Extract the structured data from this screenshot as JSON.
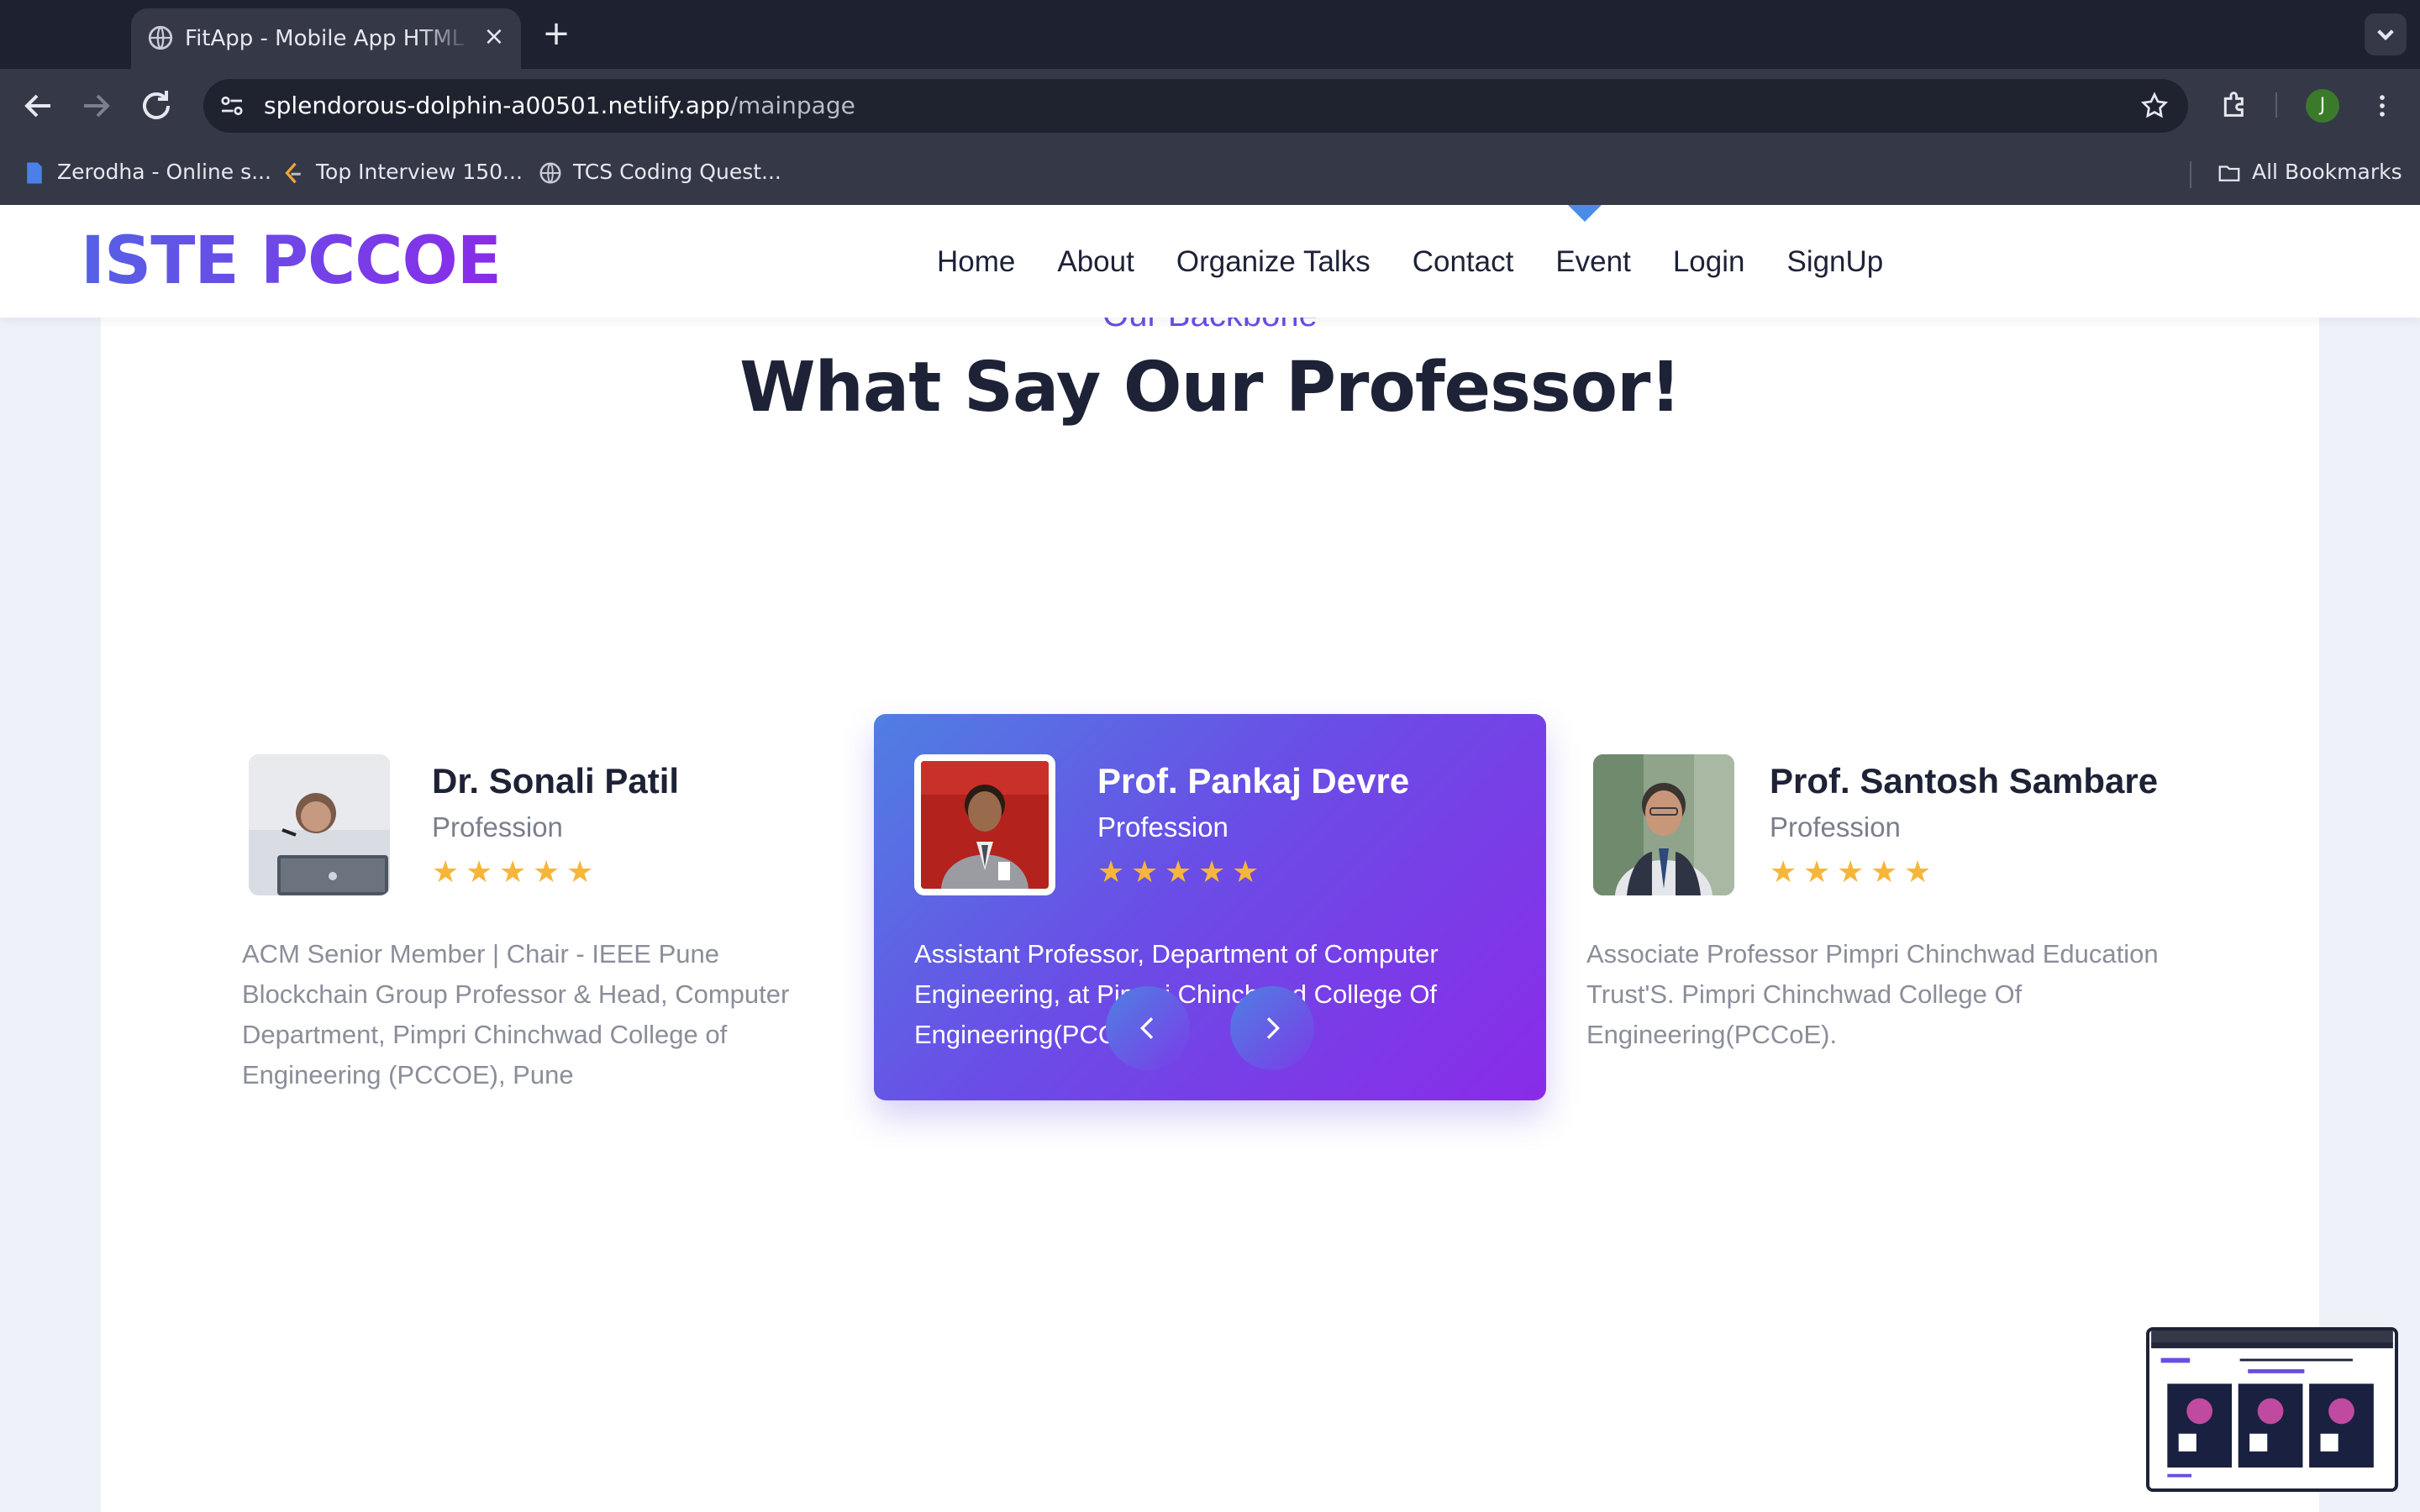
{
  "browser": {
    "tab_title": "FitApp - Mobile App HTML Template",
    "new_tab_label": "+",
    "url_host": "splendorous-dolphin-a00501.netlify.app",
    "url_path": "/mainpage",
    "profile_initial": "J",
    "bookmarks": [
      {
        "label": "Zerodha - Online s...",
        "icon": "doc-icon"
      },
      {
        "label": "Top Interview 150...",
        "icon": "leetcode-icon"
      },
      {
        "label": "TCS Coding Quest...",
        "icon": "globe-icon"
      }
    ],
    "all_bookmarks_label": "All Bookmarks"
  },
  "site": {
    "logo": "ISTE PCCOE",
    "nav": [
      "Home",
      "About",
      "Organize Talks",
      "Contact",
      "Event",
      "Login",
      "SignUp"
    ],
    "accent": "#6b4de6"
  },
  "section": {
    "eyebrow": "Our Backbone",
    "heading": "What Say Our Professor!"
  },
  "testimonials": [
    {
      "name": "Dr. Sonali Patil",
      "role": "Profession",
      "rating": 5,
      "quote": "ACM Senior Member | Chair - IEEE Pune Blockchain Group Professor & Head, Computer Department, Pimpri Chinchwad College of Engineering (PCCOE), Pune",
      "active": false
    },
    {
      "name": "Prof. Pankaj Devre",
      "role": "Profession",
      "rating": 5,
      "quote": "Assistant Professor, Department of Computer Engineering, at Pimpri Chinchwad College Of Engineering(PCCoE).",
      "active": true
    },
    {
      "name": "Prof. Santosh Sambare",
      "role": "Profession",
      "rating": 5,
      "quote": "Associate Professor Pimpri Chinchwad Education Trust'S. Pimpri Chinchwad College Of Engineering(PCCoE).",
      "active": false
    }
  ],
  "thumbnail": {
    "logo": "ISTE PCCOE",
    "title": "Upcoming Events"
  }
}
